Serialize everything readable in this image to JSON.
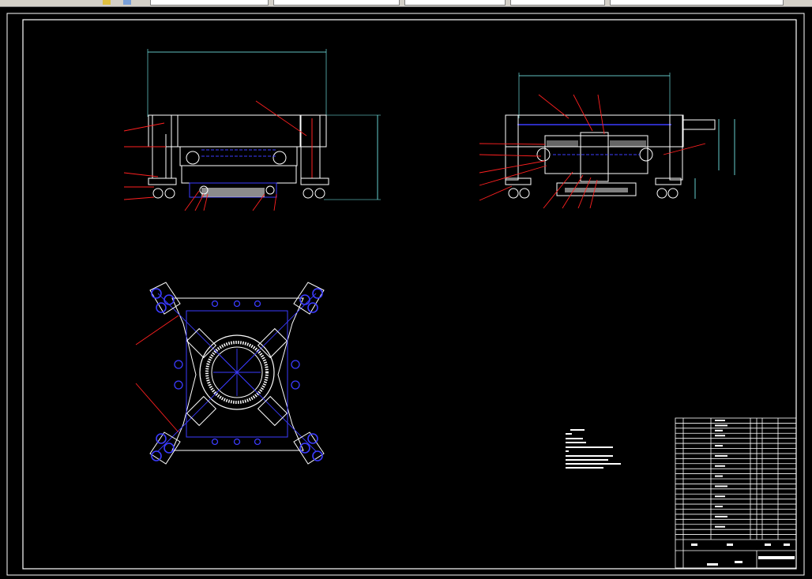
{
  "toolbar": {
    "fields": [
      "",
      "",
      "",
      "",
      ""
    ]
  },
  "colors": {
    "background": "#000000",
    "frame": "#ffffff",
    "part": "#ffffff",
    "hidden": "#3b3bff",
    "dimension": "#7fffff",
    "leader": "#ff2020",
    "hatch": "#ffffff"
  },
  "drawing": {
    "views": [
      "front-view",
      "side-view",
      "top-view"
    ],
    "title_block_rows": 24
  }
}
